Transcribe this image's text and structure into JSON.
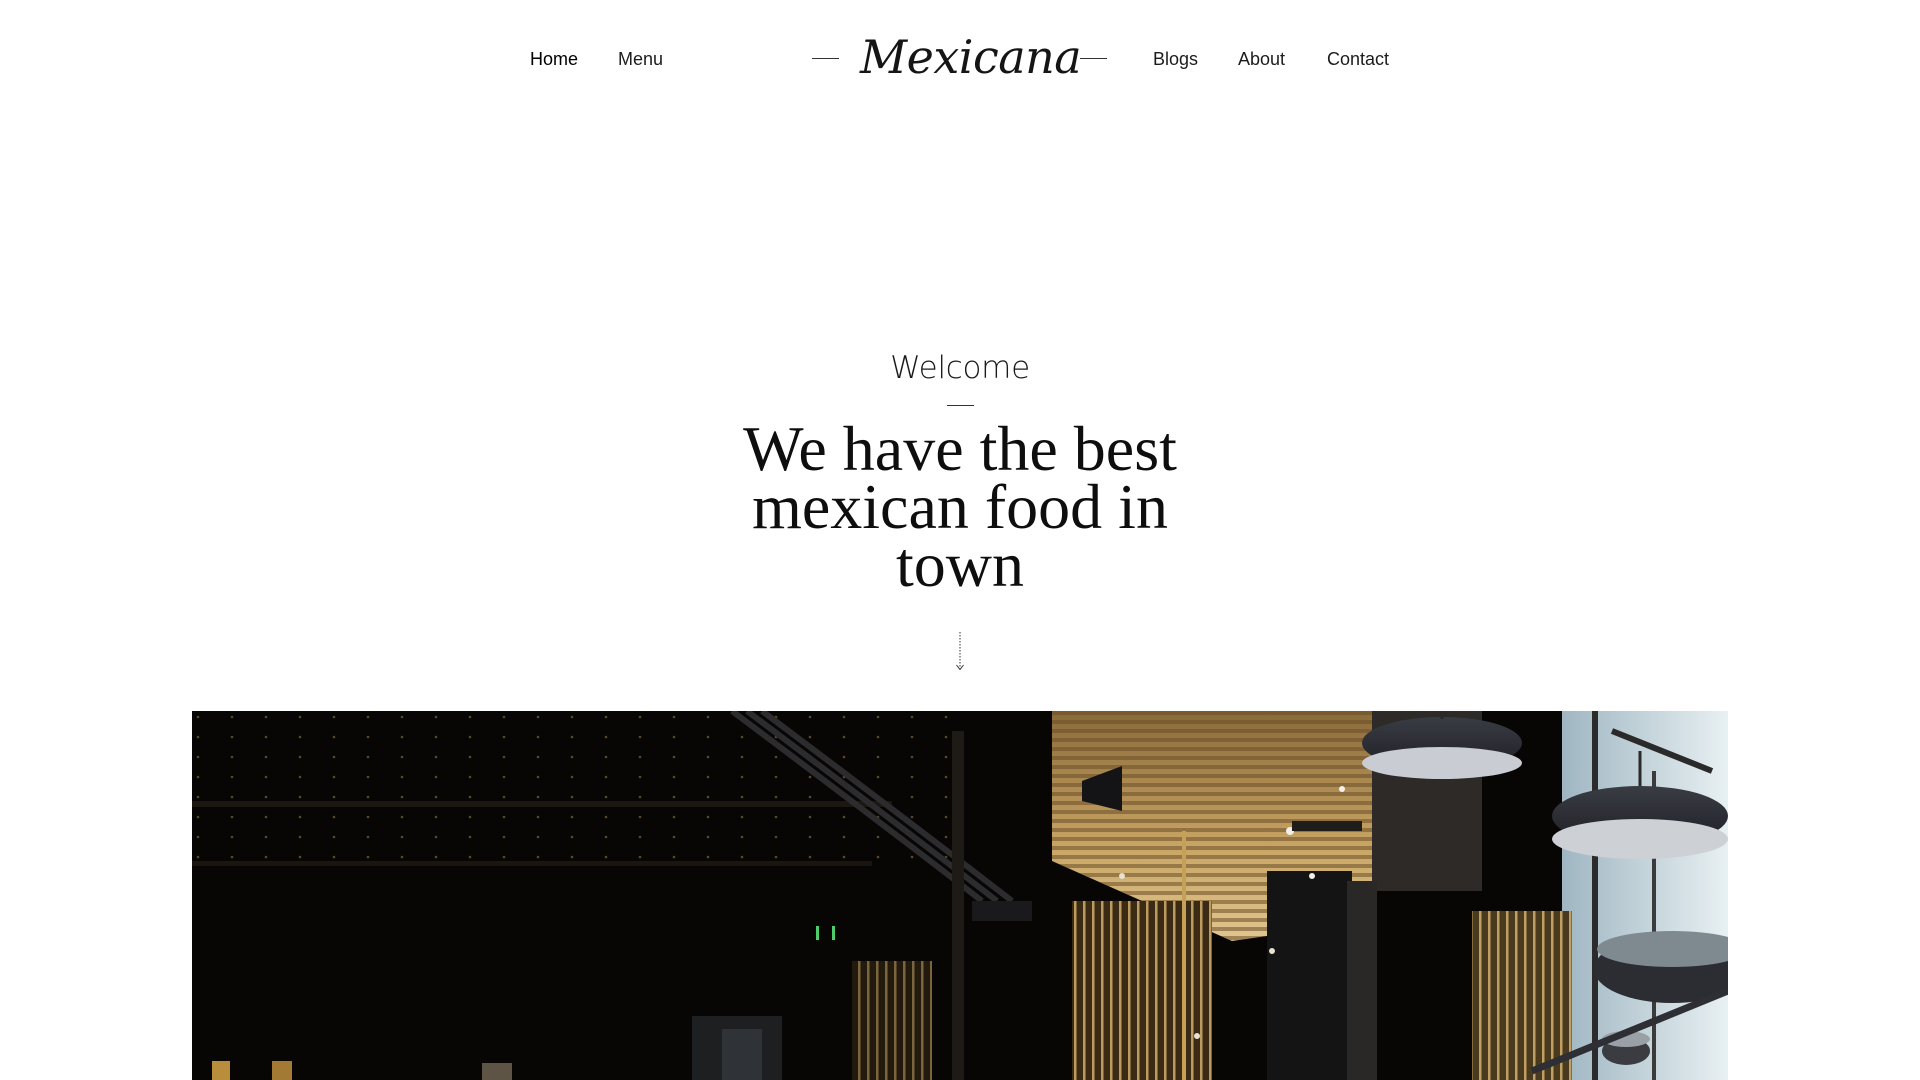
{
  "brand": {
    "logo_text": "Mexicana"
  },
  "nav": {
    "left": [
      {
        "label": "Home"
      },
      {
        "label": "Menu"
      }
    ],
    "right": [
      {
        "label": "Blogs"
      },
      {
        "label": "About"
      },
      {
        "label": "Contact"
      }
    ]
  },
  "hero": {
    "eyebrow": "Welcome",
    "headline_lines": [
      "We have the best",
      "mexican food in",
      "town"
    ],
    "scroll_icon": "dotted-down-arrow-icon"
  },
  "image": {
    "subject": "restaurant-interior-photo"
  },
  "colors": {
    "background": "#ffffff",
    "text": "#111111",
    "photo_dark": "#060504",
    "photo_wood": "#b8934f"
  }
}
